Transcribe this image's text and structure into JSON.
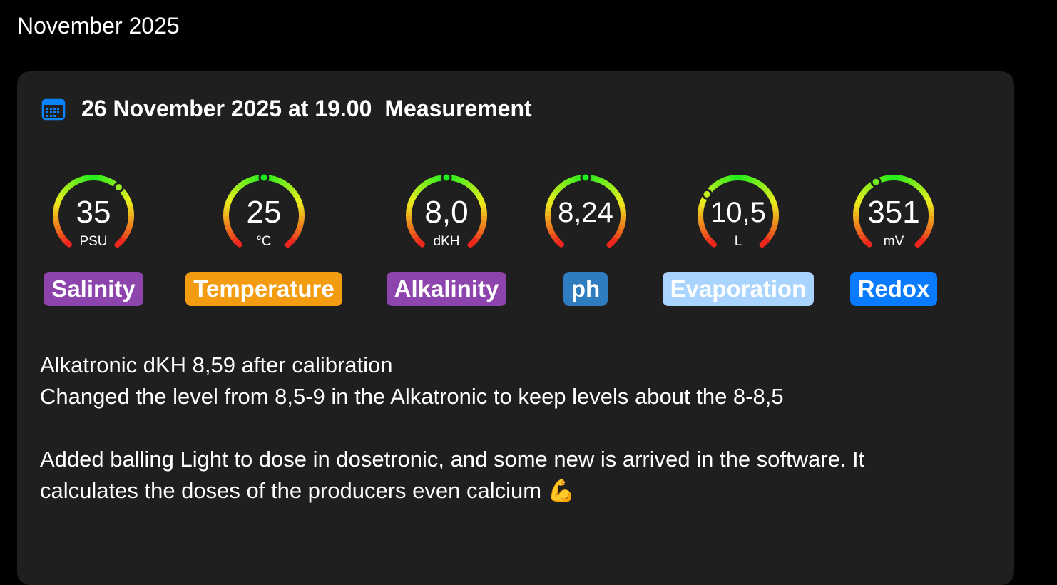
{
  "month_title": "November 2025",
  "entry": {
    "datetime": "26 November 2025 at 19.00",
    "type": "Measurement",
    "calendar_icon": "calendar-icon",
    "accent_color": "#0a84ff"
  },
  "gauges": [
    {
      "id": "salinity",
      "value": "35",
      "unit": "PSU",
      "label": "Salinity",
      "color": "#8e44ad",
      "text_color": "#ffffff",
      "marker": 0.65
    },
    {
      "id": "temperature",
      "value": "25",
      "unit": "°C",
      "label": "Temperature",
      "color": "#f39c12",
      "text_color": "#ffffff",
      "marker": 0.5
    },
    {
      "id": "alkalinity",
      "value": "8,0",
      "unit": "dKH",
      "label": "Alkalinity",
      "color": "#8e44ad",
      "text_color": "#ffffff",
      "marker": 0.5
    },
    {
      "id": "ph",
      "value": "8,24",
      "unit": "",
      "label": "ph",
      "color": "#2e7dbf",
      "text_color": "#ffffff",
      "marker": 0.5
    },
    {
      "id": "evaporation",
      "value": "10,5",
      "unit": "L",
      "label": "Evaporation",
      "color": "#a8d4ff",
      "text_color": "#ffffff",
      "marker": 0.3
    },
    {
      "id": "redox",
      "value": "351",
      "unit": "mV",
      "label": "Redox",
      "color": "#0a7aff",
      "text_color": "#ffffff",
      "marker": 0.4
    }
  ],
  "notes": [
    "Alkatronic dKH 8,59 after calibration",
    "Changed the level from 8,5-9 in the Alkatronic to keep levels about the 8-8,5",
    "",
    "Added balling Light to dose in dosetronic, and some new is arrived in the software. It",
    "calculates the doses of the producers even calcium 💪"
  ]
}
